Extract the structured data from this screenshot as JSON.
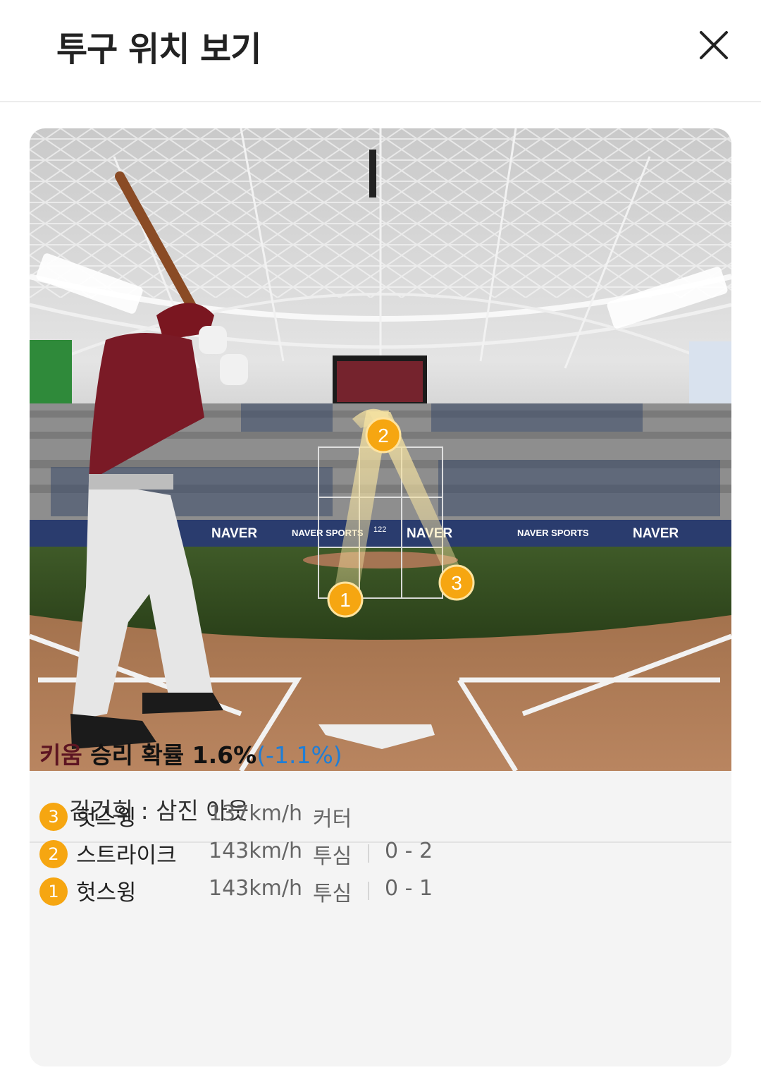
{
  "header": {
    "title": "투구 위치 보기"
  },
  "scene": {
    "banners": [
      "NAVER",
      "NAVER SPORTS",
      "122",
      "NAVER",
      "NAVER SPORTS",
      "NAVER"
    ],
    "markers": [
      "2",
      "1",
      "3"
    ]
  },
  "result": {
    "text": "김건희 : 삼진 아웃"
  },
  "win_probability": {
    "team": "키움",
    "label": "승리 확률 1.6%",
    "delta": "(-1.1%)"
  },
  "pitches": [
    {
      "num": "3",
      "result": "헛스윙",
      "speed": "137km/h",
      "type": "커터",
      "count": ""
    },
    {
      "num": "2",
      "result": "스트라이크",
      "speed": "143km/h",
      "type": "투심",
      "count": "0 - 2"
    },
    {
      "num": "1",
      "result": "헛스윙",
      "speed": "143km/h",
      "type": "투심",
      "count": "0 - 1"
    }
  ],
  "colors": {
    "marker": "#f6a611",
    "team": "#5d1522",
    "delta": "#1f7ed6"
  }
}
